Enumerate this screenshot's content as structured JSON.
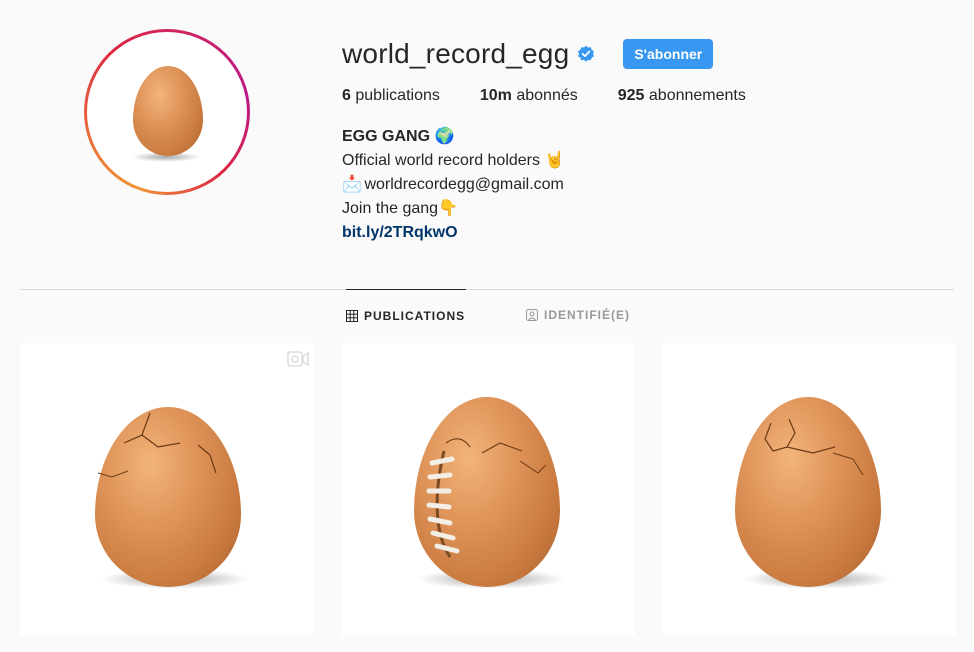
{
  "profile": {
    "username": "world_record_egg",
    "verified_icon": "verified-badge-icon",
    "follow_label": "S'abonner",
    "avatar_icon": "egg-avatar"
  },
  "stats": {
    "publications_count": "6",
    "publications_label": "publications",
    "followers_count": "10m",
    "followers_label": "abonnés",
    "following_count": "925",
    "following_label": "abonnements"
  },
  "bio": {
    "name": "EGG GANG",
    "name_emoji": "🌍",
    "line1": "Official world record holders",
    "line1_emoji": "🤘",
    "line2_emoji": "📩",
    "line2": "worldrecordegg@gmail.com",
    "line3": "Join the gang",
    "line3_emoji": "👇",
    "link": "bit.ly/2TRqkwO"
  },
  "tabs": [
    {
      "label": "PUBLICATIONS",
      "icon": "grid-icon",
      "active": true
    },
    {
      "label": "IDENTIFIÉ(E)",
      "icon": "tagged-icon",
      "active": false
    }
  ],
  "posts": [
    {
      "type": "video",
      "description_icon": "cracked-egg"
    },
    {
      "type": "image",
      "description_icon": "football-egg"
    },
    {
      "type": "image",
      "description_icon": "cracked-egg"
    }
  ],
  "colors": {
    "accent": "#3897f0",
    "link": "#003569",
    "background": "#fafafa"
  }
}
